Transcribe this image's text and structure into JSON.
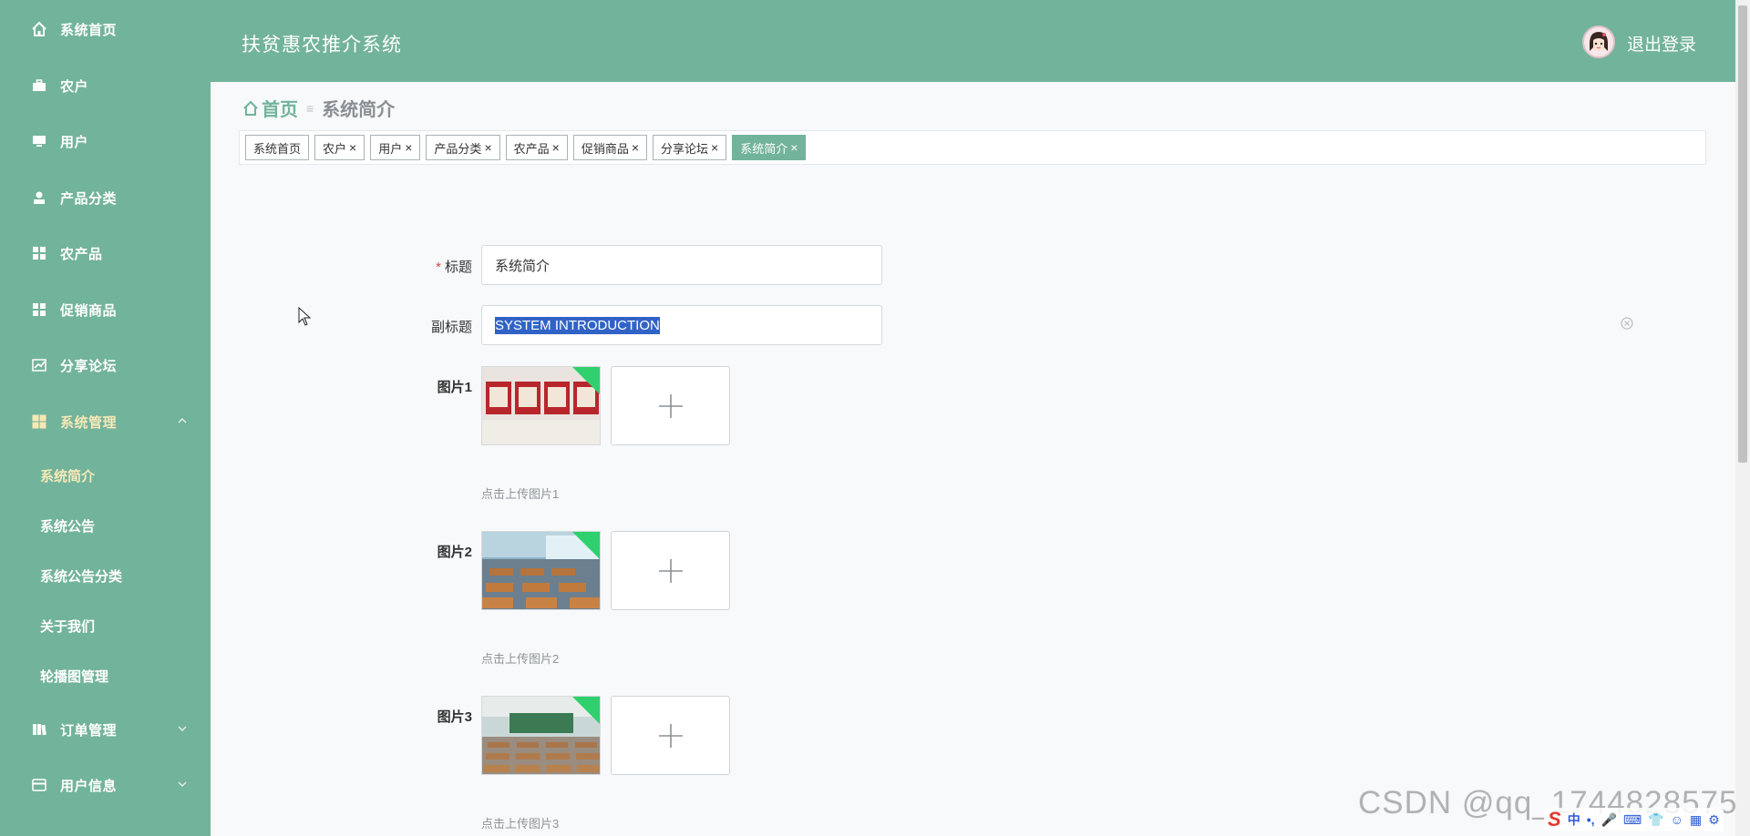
{
  "header": {
    "app_title": "扶贫惠农推介系统",
    "logout_label": "退出登录"
  },
  "sidebar": {
    "items": [
      {
        "label": "系统首页",
        "icon": "home-icon"
      },
      {
        "label": "农户",
        "icon": "briefcase-icon"
      },
      {
        "label": "用户",
        "icon": "monitor-icon"
      },
      {
        "label": "产品分类",
        "icon": "person-icon"
      },
      {
        "label": "农产品",
        "icon": "grid-icon"
      },
      {
        "label": "促销商品",
        "icon": "grid-icon"
      },
      {
        "label": "分享论坛",
        "icon": "chart-icon"
      },
      {
        "label": "系统管理",
        "icon": "grid-icon"
      },
      {
        "label": "订单管理",
        "icon": "book-icon"
      },
      {
        "label": "用户信息",
        "icon": "card-icon"
      }
    ],
    "sub_items": [
      {
        "label": "系统简介"
      },
      {
        "label": "系统公告"
      },
      {
        "label": "系统公告分类"
      },
      {
        "label": "关于我们"
      },
      {
        "label": "轮播图管理"
      }
    ]
  },
  "breadcrumb": {
    "home": "首页",
    "separator": "≡",
    "current": "系统简介"
  },
  "tabs": [
    {
      "label": "系统首页",
      "closable": false
    },
    {
      "label": "农户",
      "close": "×"
    },
    {
      "label": "用户",
      "close": "×"
    },
    {
      "label": "产品分类",
      "close": "×"
    },
    {
      "label": "农产品",
      "close": "×"
    },
    {
      "label": "促销商品",
      "close": "×"
    },
    {
      "label": "分享论坛",
      "close": "×"
    },
    {
      "label": "系统简介",
      "close": "×"
    }
  ],
  "form": {
    "title": {
      "required_mark": "*",
      "label": "标题",
      "value": "系统简介"
    },
    "subtitle": {
      "label": "副标题",
      "value": "SYSTEM INTRODUCTION"
    },
    "images": [
      {
        "label": "图片1",
        "hint": "点击上传图片1"
      },
      {
        "label": "图片2",
        "hint": "点击上传图片2"
      },
      {
        "label": "图片3",
        "hint": "点击上传图片3"
      }
    ]
  },
  "watermark": "CSDN @qq_1744828575",
  "ime": {
    "logo": "S",
    "mode": "中"
  },
  "colors": {
    "theme": "#72b39b",
    "active_menu_text": "#f6e9b7",
    "selection": "#3163c7",
    "required": "#e0463a"
  }
}
